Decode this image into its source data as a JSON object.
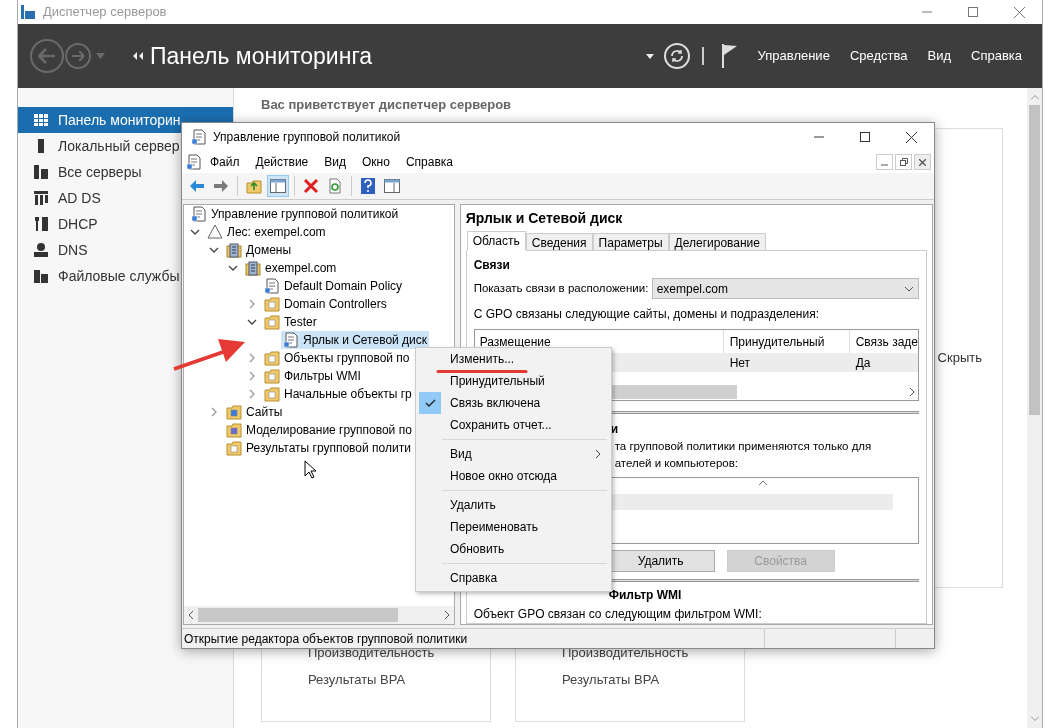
{
  "server_manager": {
    "title": "Диспетчер серверов",
    "breadcrumb": "Панель мониторинга",
    "menu": [
      "Управление",
      "Средства",
      "Вид",
      "Справка"
    ],
    "sidebar": [
      {
        "label": "Панель мониторин",
        "kind": "dashboard",
        "selected": true
      },
      {
        "label": "Локальный сервер",
        "kind": "server",
        "selected": false
      },
      {
        "label": "Все серверы",
        "kind": "servers",
        "selected": false
      },
      {
        "label": "AD DS",
        "kind": "adds",
        "selected": false
      },
      {
        "label": "DHCP",
        "kind": "dhcp",
        "selected": false
      },
      {
        "label": "DNS",
        "kind": "dns",
        "selected": false
      },
      {
        "label": "Файловые службы",
        "kind": "files",
        "selected": false
      }
    ],
    "welcome": "Вас приветствует диспетчер серверов",
    "hide_link": "Скрыть",
    "cards": [
      {
        "items": [
          "Производительность",
          "Результаты BPA"
        ]
      },
      {
        "items": [
          "Производительность",
          "Результаты BPA"
        ]
      }
    ]
  },
  "gpmc": {
    "title": "Управление групповой политикой",
    "menu": [
      "Файл",
      "Действие",
      "Вид",
      "Окно",
      "Справка"
    ],
    "toolbar": [
      {
        "kind": "back",
        "pressed": false
      },
      {
        "kind": "forward",
        "pressed": false
      },
      {
        "kind": "up",
        "pressed": false
      },
      {
        "kind": "tree",
        "pressed": true
      },
      {
        "kind": "delete",
        "pressed": false
      },
      {
        "kind": "refresh",
        "pressed": false
      },
      {
        "kind": "help",
        "pressed": false
      },
      {
        "kind": "panel",
        "pressed": false
      }
    ],
    "tree": [
      {
        "label": "Управление групповой политикой",
        "kind": "console",
        "selected": false,
        "children": [
          {
            "label": "Лес: exempel.com",
            "kind": "forest",
            "selected": false,
            "expanded": true,
            "children": [
              {
                "label": "Домены",
                "kind": "domains",
                "selected": false,
                "expanded": true,
                "children": [
                  {
                    "label": "exempel.com",
                    "kind": "domain",
                    "selected": false,
                    "expanded": true,
                    "children": [
                      {
                        "label": "Default Domain Policy",
                        "kind": "gpo-link",
                        "selected": false
                      },
                      {
                        "label": "Domain Controllers",
                        "kind": "ou",
                        "selected": false,
                        "expanded": false
                      },
                      {
                        "label": "Tester",
                        "kind": "ou",
                        "selected": false,
                        "expanded": true,
                        "children": [
                          {
                            "label": "Ярлык и Сетевой диск",
                            "kind": "gpo-link",
                            "selected": true
                          }
                        ]
                      },
                      {
                        "label": "Объекты групповой по",
                        "kind": "container",
                        "selected": false,
                        "expanded": false
                      },
                      {
                        "label": "Фильтры WMI",
                        "kind": "container",
                        "selected": false,
                        "expanded": false
                      },
                      {
                        "label": "Начальные объекты гр",
                        "kind": "container",
                        "selected": false,
                        "expanded": false
                      }
                    ]
                  }
                ]
              },
              {
                "label": "Сайты",
                "kind": "sites",
                "selected": false,
                "expanded": false
              },
              {
                "label": "Моделирование групповой по",
                "kind": "modeling",
                "selected": false
              },
              {
                "label": "Результаты групповой полити",
                "kind": "results",
                "selected": false
              }
            ]
          }
        ]
      }
    ],
    "details": {
      "title": "Ярлык и Сетевой диск",
      "tabs": [
        {
          "label": "Область",
          "selected": true
        },
        {
          "label": "Сведения",
          "selected": false
        },
        {
          "label": "Параметры",
          "selected": false
        },
        {
          "label": "Делегирование",
          "selected": false
        }
      ],
      "links_heading": "Связи",
      "location_label": "Показать связи в расположении:",
      "location_value": "exempel.com",
      "links_caption": "С GPO связаны следующие сайты, домены и подразделения:",
      "columns": [
        "Размещение",
        "Принудительный",
        "Связь заде"
      ],
      "rows": [
        {
          "column_2": "Нет",
          "column_3": "Да",
          "selected": true
        }
      ],
      "security_heading": "и",
      "security_lines": [
        "та групповой политики применяются только для",
        "ателей и компьютеров:"
      ],
      "buttons": [
        {
          "label": "Удалить",
          "disabled": false
        },
        {
          "label": "Свойства",
          "disabled": true
        }
      ],
      "wmi_heading": "Фильтр WMI",
      "wmi_text": "Объект GPO связан со следующим фильтром WMI:"
    },
    "status_bar": "Открытие редактора объектов групповой политики"
  },
  "context_menu": [
    [
      {
        "label": "Изменить...",
        "checked": false,
        "submenu": false
      },
      {
        "label": "Принудительный",
        "checked": false,
        "submenu": false
      },
      {
        "label": "Связь включена",
        "checked": true,
        "submenu": false
      },
      {
        "label": "Сохранить отчет...",
        "checked": false,
        "submenu": false
      }
    ],
    [
      {
        "label": "Вид",
        "checked": false,
        "submenu": true
      },
      {
        "label": "Новое окно отсюда",
        "checked": false,
        "submenu": false
      }
    ],
    [
      {
        "label": "Удалить",
        "checked": false,
        "submenu": false
      },
      {
        "label": "Переименовать",
        "checked": false,
        "submenu": false
      },
      {
        "label": "Обновить",
        "checked": false,
        "submenu": false
      }
    ],
    [
      {
        "label": "Справка",
        "checked": false,
        "submenu": false
      }
    ]
  ]
}
